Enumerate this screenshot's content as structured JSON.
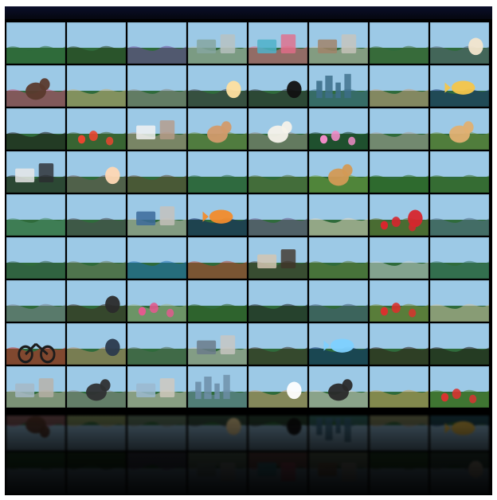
{
  "scene": {
    "rows": 9,
    "cols": 8,
    "background": "#000000"
  },
  "tiles": [
    {
      "subject": "lake-mountains",
      "sky": "#9cc9e6",
      "ground": "#2f6b3b",
      "accent": "#e9f1f6"
    },
    {
      "subject": "forest-sunburst",
      "sky": "#f6e7b8",
      "ground": "#27421f",
      "accent": "#ffffff"
    },
    {
      "subject": "lavender-field",
      "sky": "#c9c0d6",
      "ground": "#6d4a9a",
      "accent": "#f2e0a8"
    },
    {
      "subject": "living-room",
      "sky": "#e8ece9",
      "ground": "#b9c2c0",
      "accent": "#86a6a0"
    },
    {
      "subject": "yellow-wall-chair",
      "sky": "#f3e02c",
      "ground": "#e46d8a",
      "accent": "#4fb1c9"
    },
    {
      "subject": "bright-interior",
      "sky": "#f0f0ee",
      "ground": "#c8c4bb",
      "accent": "#a1846a"
    },
    {
      "subject": "winding-road",
      "sky": "#b6d2e8",
      "ground": "#3e6b3a",
      "accent": "#d7d1b6"
    },
    {
      "subject": "lake-dusk",
      "sky": "#c8d5e2",
      "ground": "#536273",
      "accent": "#f3e6cd"
    },
    {
      "subject": "puppies-pink",
      "sky": "#ec5b8f",
      "ground": "#c44a75",
      "accent": "#5a3a2d"
    },
    {
      "subject": "cocktail-beach",
      "sky": "#d9e2d2",
      "ground": "#c7b17b",
      "accent": "#f2892a"
    },
    {
      "subject": "sea-rocks",
      "sky": "#cfcac4",
      "ground": "#8d8a86",
      "accent": "#ffffff"
    },
    {
      "subject": "sunset-sea",
      "sky": "#f2a64b",
      "ground": "#3c3b45",
      "accent": "#ffe0a0"
    },
    {
      "subject": "camera-sunset",
      "sky": "#f4b45b",
      "ground": "#2a2b31",
      "accent": "#111111"
    },
    {
      "subject": "city-skyline",
      "sky": "#b9d9ef",
      "ground": "#3d6e8a",
      "accent": "#f2f6fa"
    },
    {
      "subject": "phone-hands",
      "sky": "#f3f3f3",
      "ground": "#c9a082",
      "accent": "#1f2733"
    },
    {
      "subject": "tropical-fish",
      "sky": "#1d4aa5",
      "ground": "#14306d",
      "accent": "#f6c64a"
    },
    {
      "subject": "dark-restaurant",
      "sky": "#3b2c26",
      "ground": "#1a1412",
      "accent": "#c98b4a"
    },
    {
      "subject": "red-flowers-sky",
      "sky": "#a6cde8",
      "ground": "#3f5e2c",
      "accent": "#e9452f"
    },
    {
      "subject": "vanity-room",
      "sky": "#e4dcd3",
      "ground": "#b79b88",
      "accent": "#f2f2f2"
    },
    {
      "subject": "cat-garden",
      "sky": "#b7d19a",
      "ground": "#6b8b43",
      "accent": "#d29b6b"
    },
    {
      "subject": "tabby-cat",
      "sky": "#cfd2d3",
      "ground": "#8e867d",
      "accent": "#f5f2ea"
    },
    {
      "subject": "water-lily",
      "sky": "#2c6b43",
      "ground": "#123a24",
      "accent": "#f08bc6"
    },
    {
      "subject": "fur-rug",
      "sky": "#d9d5cf",
      "ground": "#a9a39a",
      "accent": "#ffffff"
    },
    {
      "subject": "dog-field",
      "sky": "#a2c9e6",
      "ground": "#6b8c3e",
      "accent": "#e0b071"
    },
    {
      "subject": "dark-office",
      "sky": "#585c5f",
      "ground": "#2a2c2f",
      "accent": "#e8e8e8"
    },
    {
      "subject": "beach-dusk",
      "sky": "#f1b48c",
      "ground": "#6b5a58",
      "accent": "#ffd8b4"
    },
    {
      "subject": "pine-cones",
      "sky": "#e2e5e0",
      "ground": "#5f4a33",
      "accent": "#3f6b2e"
    },
    {
      "subject": "river-forest",
      "sky": "#a6c4db",
      "ground": "#2f6a44",
      "accent": "#8ec7d7"
    },
    {
      "subject": "elephant",
      "sky": "#b9c7aa",
      "ground": "#546f3a",
      "accent": "#6e6a64"
    },
    {
      "subject": "puppy-grass",
      "sky": "#d2e6b6",
      "ground": "#6c9a3a",
      "accent": "#d39a55"
    },
    {
      "subject": "fern-sun",
      "sky": "#d9efb0",
      "ground": "#2e6a24",
      "accent": "#ffffff"
    },
    {
      "subject": "vegetables-house",
      "sky": "#9b4d3e",
      "ground": "#3a6d2d",
      "accent": "#e23b2a"
    },
    {
      "subject": "cactus-bowl",
      "sky": "#87c1c8",
      "ground": "#4b8d69",
      "accent": "#e9e3cf"
    },
    {
      "subject": "bare-trees",
      "sky": "#a9b9cb",
      "ground": "#4a4a52",
      "accent": "#d7d1c6"
    },
    {
      "subject": "white-chair",
      "sky": "#f3f3f1",
      "ground": "#c7c2bb",
      "accent": "#3c6a9a"
    },
    {
      "subject": "coral-reef",
      "sky": "#1c3aa8",
      "ground": "#102360",
      "accent": "#f28c2c"
    },
    {
      "subject": "purple-dawn",
      "sky": "#b8a5cf",
      "ground": "#6b5a8c",
      "accent": "#f4d2a2"
    },
    {
      "subject": "balloon-sky",
      "sky": "#bcd6ea",
      "ground": "#e6d8c4",
      "accent": "#f08a2a"
    },
    {
      "subject": "poppies-sunset",
      "sky": "#f1a13a",
      "ground": "#5e6e2b",
      "accent": "#d7262d"
    },
    {
      "subject": "mountain-lake",
      "sky": "#a9cbe5",
      "ground": "#53708a",
      "accent": "#f5f5f5"
    },
    {
      "subject": "forest-hills",
      "sky": "#9ab7bd",
      "ground": "#315d46",
      "accent": "#dfe9e6"
    },
    {
      "subject": "girl-hat",
      "sky": "#cfe2f0",
      "ground": "#6a7c5c",
      "accent": "#e1c9a5"
    },
    {
      "subject": "pool-float",
      "sky": "#3aa7dc",
      "ground": "#1f6fb2",
      "accent": "#f07a24"
    },
    {
      "subject": "fruit-platter",
      "sky": "#f0ebe1",
      "ground": "#b8442d",
      "accent": "#f2c24f"
    },
    {
      "subject": "desk-items",
      "sky": "#6c5a47",
      "ground": "#403429",
      "accent": "#d3c6b2"
    },
    {
      "subject": "stone-cairn",
      "sky": "#d5e2bf",
      "ground": "#5b7a3a",
      "accent": "#6c6d6b"
    },
    {
      "subject": "notebook-camera",
      "sky": "#eef0ef",
      "ground": "#c9d1d3",
      "accent": "#222629"
    },
    {
      "subject": "lake-island",
      "sky": "#b8d7ea",
      "ground": "#36735e",
      "accent": "#e7f3f3"
    },
    {
      "subject": "hammock",
      "sky": "#cfd6dd",
      "ground": "#7b8793",
      "accent": "#2e3238"
    },
    {
      "subject": "zen-stones-sunset",
      "sky": "#f3b160",
      "ground": "#3a2a21",
      "accent": "#2b2b2b"
    },
    {
      "subject": "zen-stones-flower",
      "sky": "#dfe8d3",
      "ground": "#9fb78a",
      "accent": "#e25a8e"
    },
    {
      "subject": "green-bokeh",
      "sky": "#87b55a",
      "ground": "#2e5d23",
      "accent": "#e6f29b"
    },
    {
      "subject": "shrimp-plate",
      "sky": "#3b3d40",
      "ground": "#1f2022",
      "accent": "#e37944"
    },
    {
      "subject": "sea-horizon",
      "sky": "#b4c9dc",
      "ground": "#475f78",
      "accent": "#f6f6f6"
    },
    {
      "subject": "poppy-meadow",
      "sky": "#f0b25a",
      "ground": "#7b8c3a",
      "accent": "#d8322e"
    },
    {
      "subject": "beach-drink",
      "sky": "#d5e9f3",
      "ground": "#d1c4a5",
      "accent": "#f36f5a"
    },
    {
      "subject": "bicycle-red",
      "sky": "#e63b34",
      "ground": "#c22c27",
      "accent": "#1c1c1c"
    },
    {
      "subject": "woman-sunset-beach",
      "sky": "#f2d6a4",
      "ground": "#b58d66",
      "accent": "#2b3a4d"
    },
    {
      "subject": "mountain-trees",
      "sky": "#b8d0e8",
      "ground": "#4f6a52",
      "accent": "#eaf1f6"
    },
    {
      "subject": "white-office",
      "sky": "#f2f2f2",
      "ground": "#c9c7c2",
      "accent": "#6b7b8a"
    },
    {
      "subject": "tree-roots",
      "sky": "#6a8a5f",
      "ground": "#3a2d22",
      "accent": "#b79a7a"
    },
    {
      "subject": "underwater-fish",
      "sky": "#1c5dc0",
      "ground": "#0a2a66",
      "accent": "#7ed1ff"
    },
    {
      "subject": "wood-table",
      "sky": "#5a3a2a",
      "ground": "#2d1c14",
      "accent": "#c98d55"
    },
    {
      "subject": "food-bowl",
      "sky": "#3a2c22",
      "ground": "#1d1510",
      "accent": "#e2a036"
    },
    {
      "subject": "bedroom-window",
      "sky": "#eeeae4",
      "ground": "#b9b2a8",
      "accent": "#a6b8c6"
    },
    {
      "subject": "persian-cat",
      "sky": "#d6dde3",
      "ground": "#8e8e8e",
      "accent": "#2f3133"
    },
    {
      "subject": "bedroom-pastel",
      "sky": "#f1ece6",
      "ground": "#d2c9be",
      "accent": "#9bb9cf"
    },
    {
      "subject": "city-coast",
      "sky": "#b8d7ef",
      "ground": "#6d8ea8",
      "accent": "#efefef"
    },
    {
      "subject": "beach-sunset",
      "sky": "#f0c06b",
      "ground": "#caa174",
      "accent": "#ffffff"
    },
    {
      "subject": "puppy-lying",
      "sky": "#f3f3f3",
      "ground": "#d6d2cc",
      "accent": "#2a2a2a"
    },
    {
      "subject": "rooster",
      "sky": "#f4f1e6",
      "ground": "#c6a35c",
      "accent": "#a12f1f"
    },
    {
      "subject": "red-flowers",
      "sky": "#bfe0f2",
      "ground": "#4c7d2c",
      "accent": "#d83431"
    }
  ]
}
